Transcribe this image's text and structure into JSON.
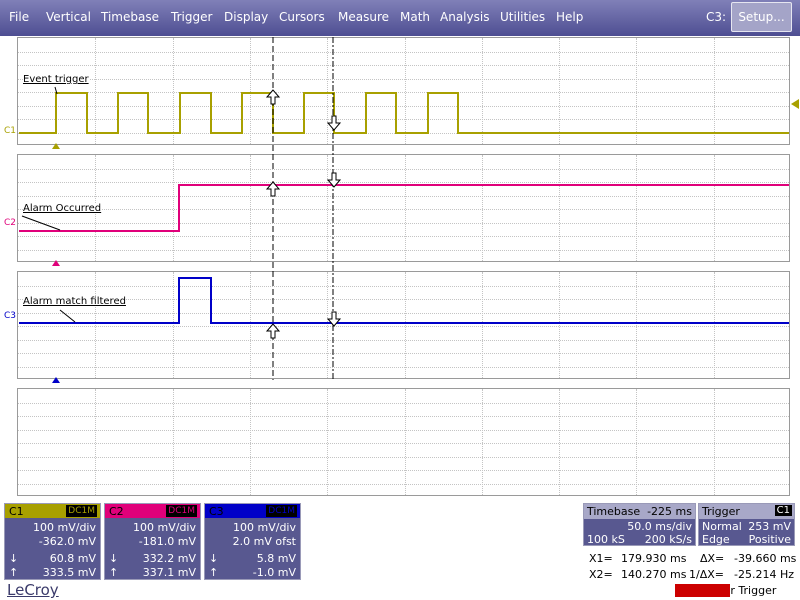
{
  "menu": [
    "File",
    "Vertical",
    "Timebase",
    "Trigger",
    "Display",
    "Cursors",
    "Measure",
    "Math",
    "Analysis",
    "Utilities",
    "Help"
  ],
  "active_channel": "C3:",
  "setup_label": "Setup...",
  "traces": [
    {
      "id": "C1",
      "label": "Event trigger",
      "color": "#a8a000"
    },
    {
      "id": "C2",
      "label": "Alarm Occurred",
      "color": "#e0007a"
    },
    {
      "id": "C3",
      "label": "Alarm match filtered",
      "color": "#0000c8"
    }
  ],
  "channels": [
    {
      "name": "C1",
      "coupling": "DC1M",
      "head_color": "#a8a000",
      "vdiv": "100 mV/div",
      "offset": "-362.0 mV",
      "cursor_down": "60.8 mV",
      "cursor_up": "333.5 mV"
    },
    {
      "name": "C2",
      "coupling": "DC1M",
      "head_color": "#e0007a",
      "vdiv": "100 mV/div",
      "offset": "-181.0 mV",
      "cursor_down": "332.2 mV",
      "cursor_up": "337.1 mV"
    },
    {
      "name": "C3",
      "coupling": "DC1M",
      "head_color": "#0000c8",
      "vdiv": "100 mV/div",
      "offset": "2.0 mV ofst",
      "cursor_down": "5.8 mV",
      "cursor_up": "-1.0 mV"
    }
  ],
  "timebase": {
    "title": "Timebase",
    "delay": "-225 ms",
    "per_div": "50.0 ms/div",
    "samples": "100 kS",
    "rate": "200 kS/s"
  },
  "trigger": {
    "title": "Trigger",
    "source": "C1",
    "mode": "Normal",
    "level": "253 mV",
    "type": "Edge",
    "slope": "Positive"
  },
  "cursors": {
    "x1_label": "X1=",
    "x1": "179.930 ms",
    "x2_label": "X2=",
    "x2": "140.270 ms",
    "dx_label": "ΔX=",
    "dx": "-39.660 ms",
    "inv_label": "1/ΔX=",
    "inv": "-25.214 Hz"
  },
  "logo": "LeCroy",
  "status": {
    "highlight": "Waiting fo",
    "rest": "r Trigger"
  },
  "colors": {
    "menubar": "#5a5a9a",
    "descriptor_bg": "#585890",
    "c1": "#a8a000",
    "c2": "#e0007a",
    "c3": "#0000c8"
  }
}
